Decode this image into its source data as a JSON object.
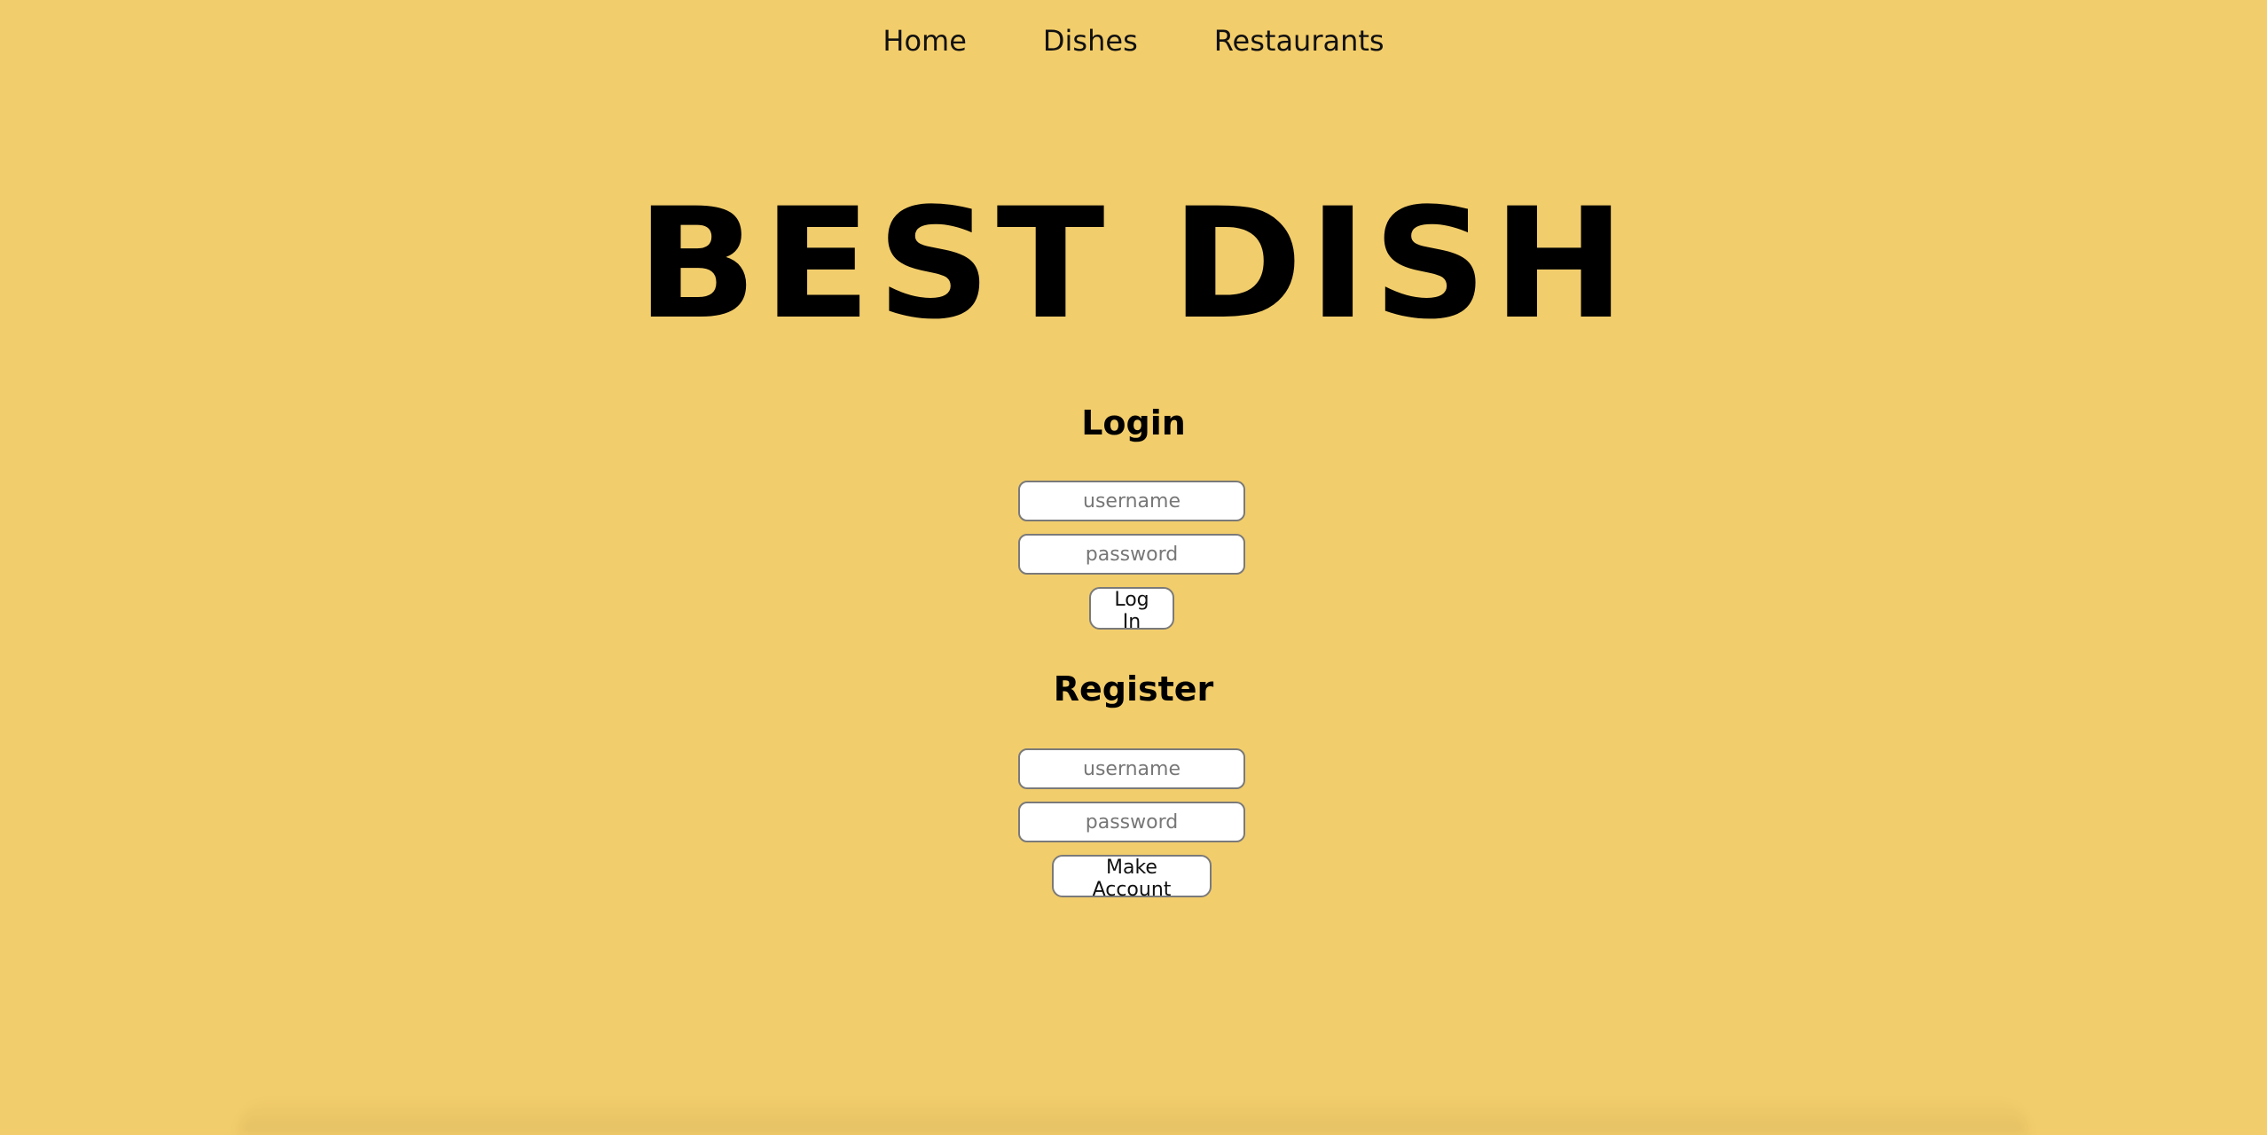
{
  "nav": {
    "items": [
      "Home",
      "Dishes",
      "Restaurants"
    ]
  },
  "hero": {
    "title": "BEST DISH"
  },
  "login": {
    "title": "Login",
    "username_placeholder": "username",
    "password_placeholder": "password",
    "submit_label": "Log In"
  },
  "register": {
    "title": "Register",
    "username_placeholder": "username",
    "password_placeholder": "password",
    "submit_label": "Make Account"
  },
  "colors": {
    "background": "#f2cd6b",
    "text": "#000000",
    "field_border": "#7a7a7a"
  }
}
